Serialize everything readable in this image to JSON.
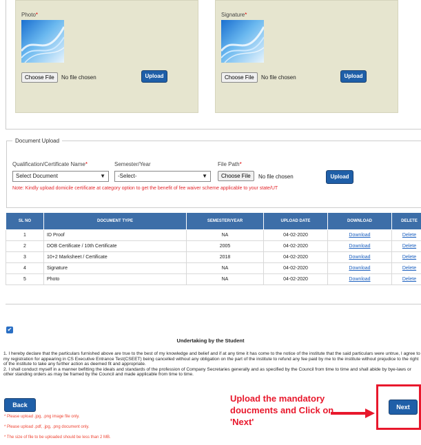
{
  "photo": {
    "label": "Photo",
    "choose_label": "Choose File",
    "no_file": "No file chosen",
    "upload_label": "Upload"
  },
  "signature": {
    "label": "Signature",
    "choose_label": "Choose File",
    "no_file": "No file chosen",
    "upload_label": "Upload"
  },
  "required_mark": "*",
  "document_upload": {
    "legend": "Document Upload",
    "qualification_label": "Qualification/Certificate Name",
    "qualification_selected": "Select Document",
    "semester_label": "Semester/Year",
    "semester_selected": "-Select-",
    "file_path_label": "File Path",
    "choose_label": "Choose File",
    "no_file": "No file chosen",
    "upload_label": "Upload",
    "note": "Note: Kindly upload domicile certificate at category option to get the benefit of fee waiver scheme applicable to your state/UT"
  },
  "table": {
    "headers": [
      "SL NO",
      "DOCUMENT TYPE",
      "SEMESTER/YEAR",
      "UPLOAD DATE",
      "DOWNLOAD",
      "DELETE"
    ],
    "rows": [
      {
        "sl": "1",
        "type": "ID Proof",
        "sem": "NA",
        "date": "04-02-2020",
        "download": "Download",
        "delete": "Delete"
      },
      {
        "sl": "2",
        "type": "DOB Certificate / 10th Certificate",
        "sem": "2005",
        "date": "04-02-2020",
        "download": "Download",
        "delete": "Delete"
      },
      {
        "sl": "3",
        "type": "10+2 Marksheet / Certificate",
        "sem": "2018",
        "date": "04-02-2020",
        "download": "Download",
        "delete": "Delete"
      },
      {
        "sl": "4",
        "type": "Signature",
        "sem": "NA",
        "date": "04-02-2020",
        "download": "Download",
        "delete": "Delete"
      },
      {
        "sl": "5",
        "type": "Photo",
        "sem": "NA",
        "date": "04-02-2020",
        "download": "Download",
        "delete": "Delete"
      }
    ]
  },
  "undertaking": {
    "checked": true,
    "title": "Undertaking by the Student",
    "p1": "1. I hereby declare that the particulars furnished above are true to the best of my knowledge and belief and if at any time it has come to the notice of the institute that the said particulars were untrue, I agree to my registration for appearing in CS Executive Entrance Test(CSEET) being cancelled without any obligation on the part of the institute to refund any fee paid by me to the institute without prejudice to the right of the institute to take any further action as deemed fit and appropriate.",
    "p2": "2. I shall conduct myself in a manner befitting the ideals and standards of the profession of Company Secretaries generally and as specified by the Council from time to time and shall abide by bye-laws or other standing orders as may be framed by the Council and made applicable from time to time."
  },
  "buttons": {
    "back": "Back",
    "next": "Next"
  },
  "notes": [
    "* Please upload .jpg, .png image file only.",
    "* Please upload .pdf, .jpg, .png document only.",
    "* The size of file to be uploaded should be less than 2 MB."
  ],
  "callout": [
    "Upload the mandatory",
    "doucments and Click on",
    "'Next'"
  ],
  "colors": {
    "panel": "#e6e5cf",
    "header_blue": "#3d6ea8",
    "button_blue": "#1f5fa8",
    "callout_red": "#e8182c"
  }
}
